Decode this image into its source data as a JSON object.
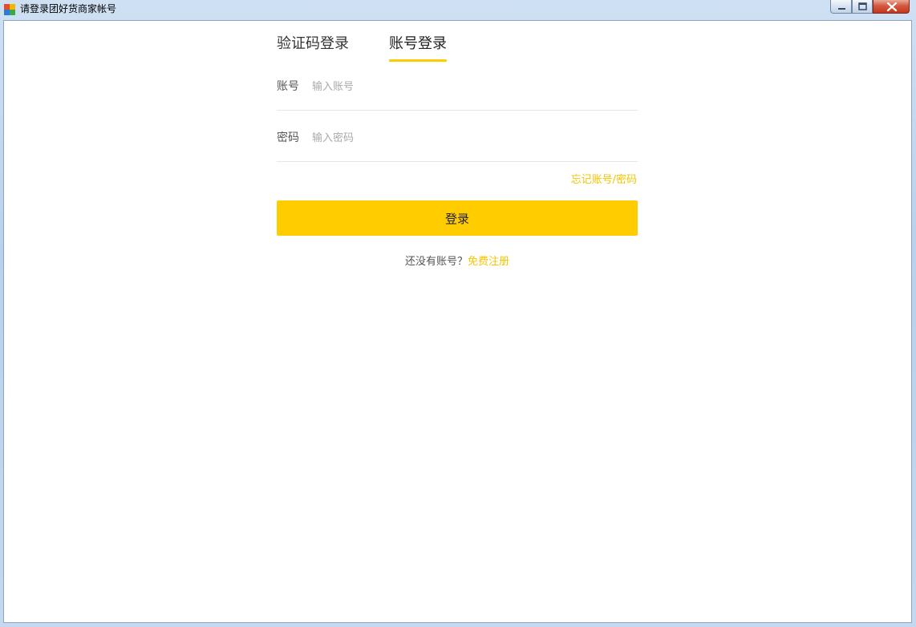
{
  "window": {
    "title": "请登录团好货商家帐号",
    "app_icon": "app-grid-icon",
    "controls": {
      "minimize": "minimize-icon",
      "maximize": "maximize-icon",
      "close": "close-icon"
    }
  },
  "tabs": [
    {
      "label": "验证码登录",
      "active": false
    },
    {
      "label": "账号登录",
      "active": true
    }
  ],
  "form": {
    "account": {
      "label": "账号",
      "placeholder": "输入账号",
      "value": ""
    },
    "password": {
      "label": "密码",
      "placeholder": "输入密码",
      "value": ""
    },
    "forgot_link": "忘记账号/密码",
    "login_button": "登录"
  },
  "register": {
    "prompt": "还没有账号？",
    "link": "免费注册"
  },
  "colors": {
    "accent": "#ffcc00",
    "link": "#f5c400",
    "text": "#333333",
    "placeholder": "#aaaaaa",
    "divider": "#e6e6e6"
  }
}
